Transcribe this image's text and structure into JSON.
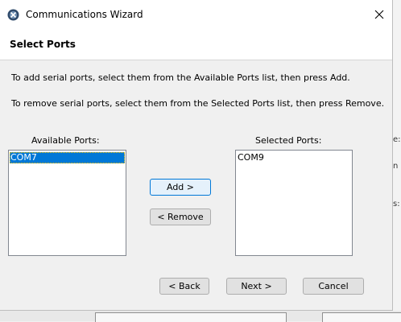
{
  "window": {
    "title": "Communications Wizard",
    "icons": {
      "app": "wizard-app-icon",
      "close": "close-icon"
    }
  },
  "header": {
    "title": "Select Ports"
  },
  "instructions": {
    "add": "To add serial ports, select them from the Available Ports list, then press Add.",
    "remove": "To remove serial ports, select them from the Selected Ports list, then press Remove."
  },
  "available": {
    "label": "Available Ports:",
    "items": [
      "COM7"
    ],
    "selected_index": 0
  },
  "selected": {
    "label": "Selected Ports:",
    "items": [
      "COM9"
    ]
  },
  "buttons": {
    "add": "Add >",
    "remove": "< Remove",
    "back": "< Back",
    "next": "Next >",
    "cancel": "Cancel"
  },
  "background": {
    "right_edge_fragments": [
      "e:",
      "n",
      "s:"
    ]
  },
  "colors": {
    "selection": "#0078d7",
    "default_button_border": "#0078d7"
  }
}
